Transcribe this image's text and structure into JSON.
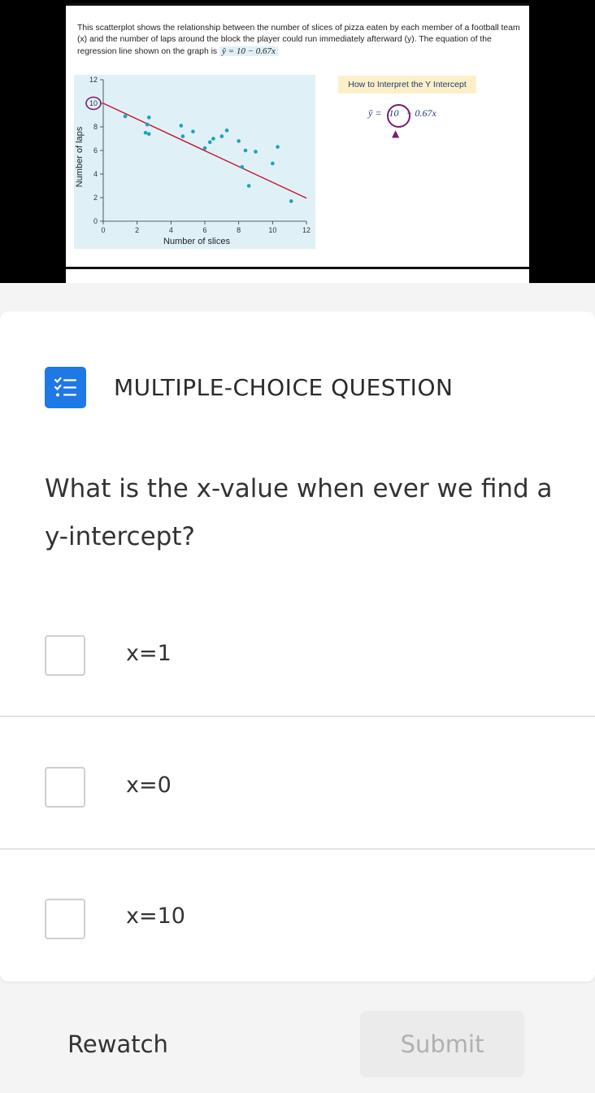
{
  "video": {
    "slide_text_1": "This scatterplot shows the relationship between the number of slices of pizza eaten by each member of a football team (x) and the number of laps around the block the player could run immediately afterward (y). The equation of the regression line shown on the graph is",
    "slide_equation": "ŷ = 10 − 0.67x",
    "interpret_title": "How to Interpret the Y Intercept",
    "interpret_eq_prefix": "ŷ =",
    "interpret_eq_intercept": "10",
    "interpret_eq_suffix": "− 0.67x",
    "arrow_glyph": "▲"
  },
  "chart_data": {
    "type": "scatter",
    "xlabel": "Number of slices",
    "ylabel": "Number of laps",
    "xlim": [
      0,
      12
    ],
    "ylim": [
      0,
      12
    ],
    "x_ticks": [
      0,
      2,
      4,
      6,
      8,
      10,
      12
    ],
    "y_ticks": [
      0,
      2,
      4,
      6,
      8,
      10,
      12
    ],
    "points": [
      {
        "x": 1.3,
        "y": 8.9
      },
      {
        "x": 2.5,
        "y": 7.5
      },
      {
        "x": 2.7,
        "y": 7.4
      },
      {
        "x": 2.6,
        "y": 8.2
      },
      {
        "x": 2.7,
        "y": 8.8
      },
      {
        "x": 4.6,
        "y": 8.1
      },
      {
        "x": 4.7,
        "y": 7.2
      },
      {
        "x": 5.3,
        "y": 7.6
      },
      {
        "x": 6.0,
        "y": 6.2
      },
      {
        "x": 6.3,
        "y": 6.7
      },
      {
        "x": 6.5,
        "y": 7.0
      },
      {
        "x": 7.0,
        "y": 7.2
      },
      {
        "x": 7.3,
        "y": 7.7
      },
      {
        "x": 8.0,
        "y": 6.8
      },
      {
        "x": 8.4,
        "y": 6.0
      },
      {
        "x": 8.2,
        "y": 4.6
      },
      {
        "x": 9.0,
        "y": 5.9
      },
      {
        "x": 10.0,
        "y": 4.9
      },
      {
        "x": 10.3,
        "y": 6.3
      },
      {
        "x": 8.6,
        "y": 3.0
      },
      {
        "x": 11.1,
        "y": 1.7
      }
    ],
    "regression_line": {
      "intercept": 10,
      "slope": -0.67,
      "x_range": [
        0,
        12
      ]
    },
    "highlight_tick": 10,
    "point_color": "#1aa3b8",
    "line_color": "#c8102e",
    "plot_bg": "#dff1f7",
    "highlight_color": "#7a1a73"
  },
  "question": {
    "type_label": "MULTIPLE-CHOICE QUESTION",
    "text": "What is the x-value when ever we find a y-intercept?",
    "options": [
      {
        "label": "x=1",
        "checked": false
      },
      {
        "label": "x=0",
        "checked": false
      },
      {
        "label": "x=10",
        "checked": false
      }
    ]
  },
  "buttons": {
    "rewatch": "Rewatch",
    "submit": "Submit"
  },
  "icons": {
    "question_type": "checklist-icon"
  },
  "colors": {
    "accent": "#1e78e6",
    "submit_disabled_bg": "#ebebeb"
  }
}
